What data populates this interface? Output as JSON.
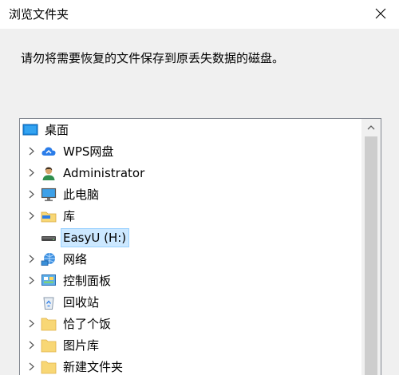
{
  "window": {
    "title": "浏览文件夹",
    "instruction": "请勿将需要恢复的文件保存到原丢失数据的磁盘。"
  },
  "tree": {
    "items": [
      {
        "label": "桌面",
        "icon": "desktop-icon",
        "expandable": false,
        "selected": false,
        "root": true
      },
      {
        "label": "WPS网盘",
        "icon": "cloud-drive-icon",
        "expandable": true,
        "selected": false
      },
      {
        "label": "Administrator",
        "icon": "user-icon",
        "expandable": true,
        "selected": false
      },
      {
        "label": "此电脑",
        "icon": "computer-icon",
        "expandable": true,
        "selected": false
      },
      {
        "label": "库",
        "icon": "library-icon",
        "expandable": true,
        "selected": false
      },
      {
        "label": "EasyU (H:)",
        "icon": "drive-icon",
        "expandable": false,
        "selected": true
      },
      {
        "label": "网络",
        "icon": "network-icon",
        "expandable": true,
        "selected": false
      },
      {
        "label": "控制面板",
        "icon": "control-panel-icon",
        "expandable": true,
        "selected": false
      },
      {
        "label": "回收站",
        "icon": "recycle-bin-icon",
        "expandable": false,
        "selected": false
      },
      {
        "label": "恰了个饭",
        "icon": "folder-icon",
        "expandable": true,
        "selected": false
      },
      {
        "label": "图片库",
        "icon": "folder-icon",
        "expandable": true,
        "selected": false
      },
      {
        "label": "新建文件夹",
        "icon": "folder-icon",
        "expandable": true,
        "selected": false
      }
    ]
  },
  "colors": {
    "selection_bg": "#cce8ff",
    "selection_border": "#99d1ff",
    "folder": "#f8d775"
  }
}
